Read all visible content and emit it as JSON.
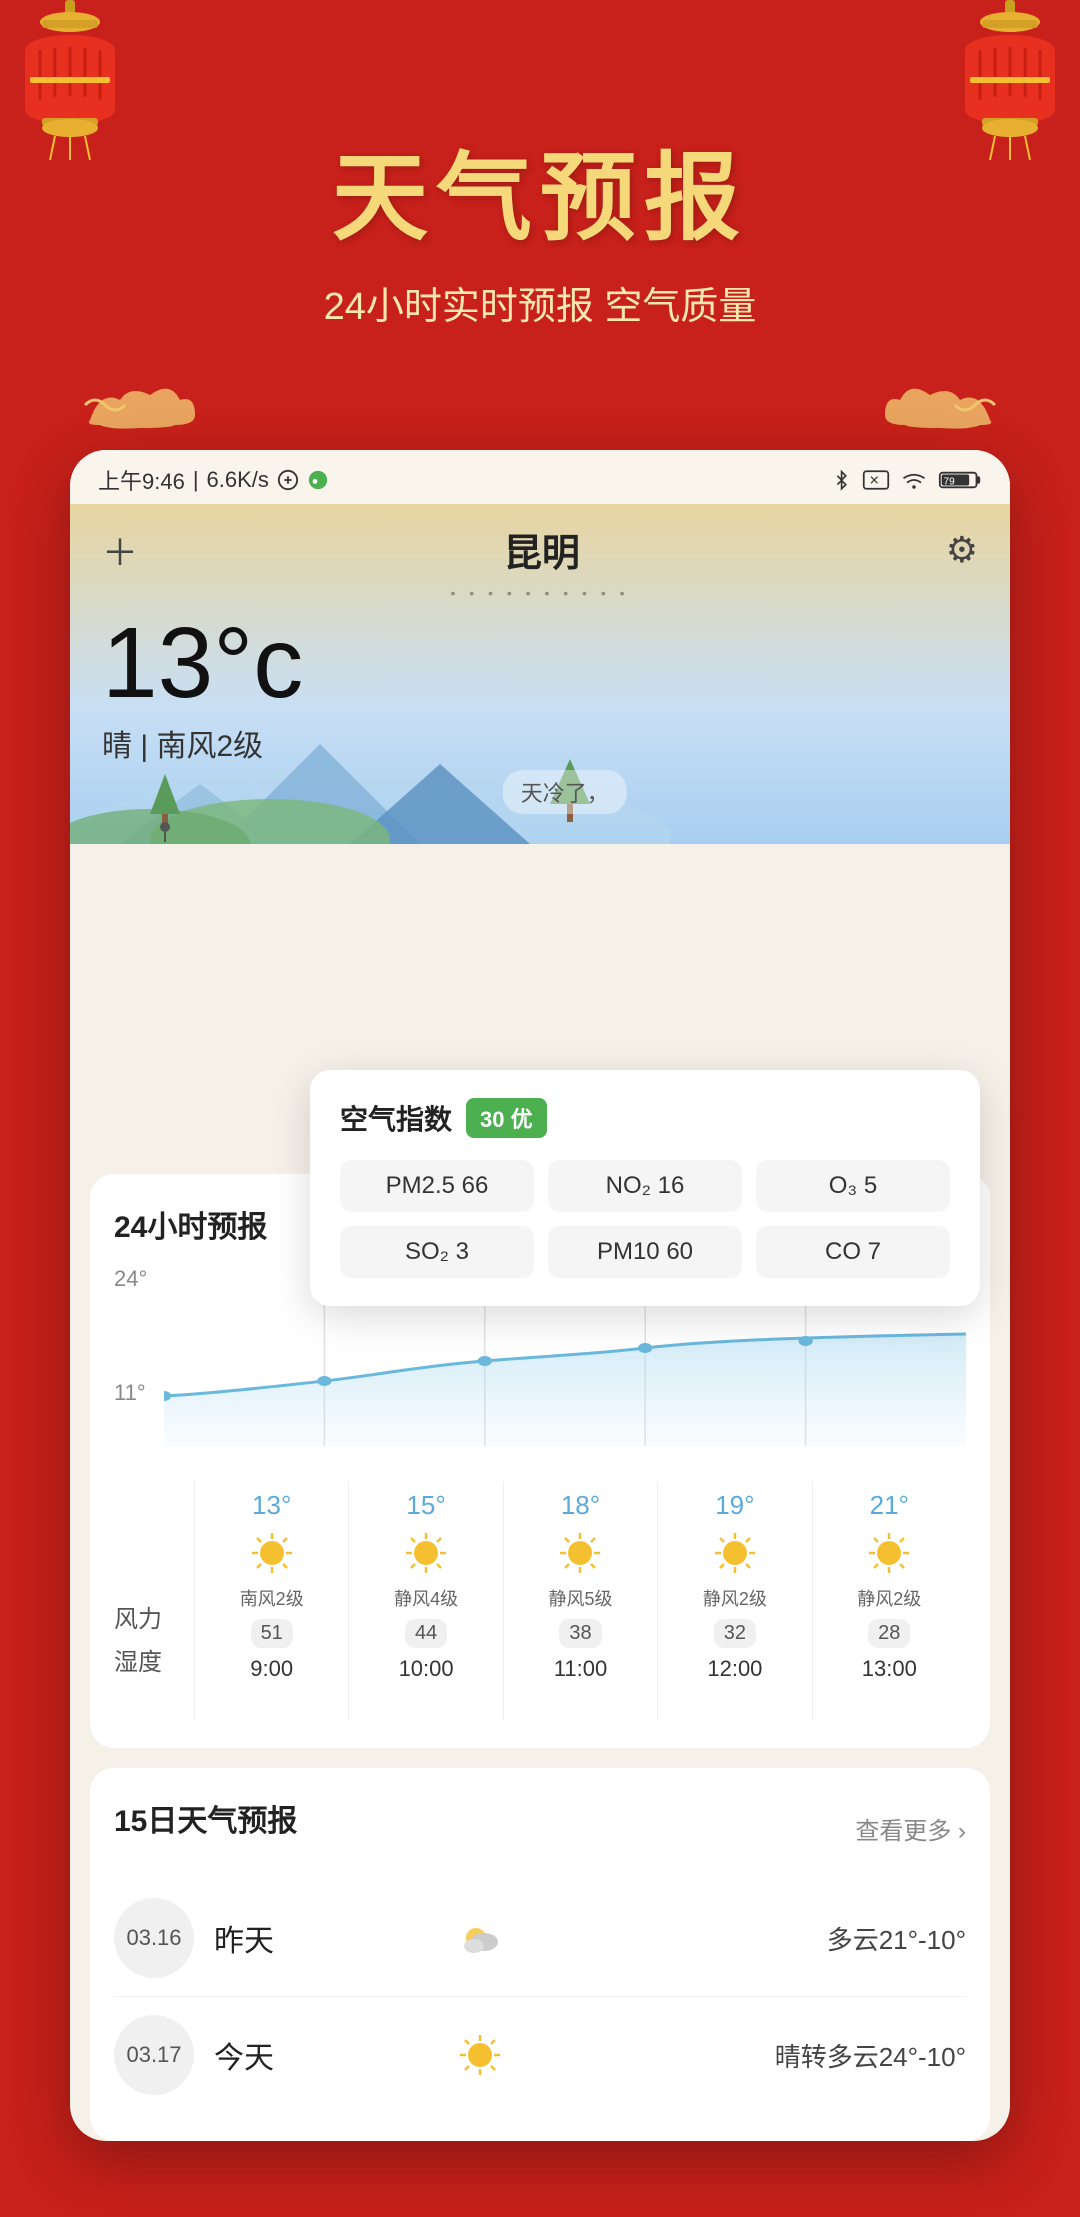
{
  "app": {
    "title": "天气预报",
    "subtitle": "24小时实时预报 空气质量"
  },
  "status_bar": {
    "time": "上午9:46",
    "network": "6.6K/s",
    "battery": "79"
  },
  "weather": {
    "city": "昆明",
    "temperature": "13°c",
    "description": "晴 | 南风2级",
    "tip": "天冷了，"
  },
  "air_quality": {
    "label": "空气指数",
    "badge": "30 优",
    "items": [
      {
        "name": "PM2.5",
        "value": "66"
      },
      {
        "name": "NO₂",
        "value": "16"
      },
      {
        "name": "O₃",
        "value": "5"
      },
      {
        "name": "SO₂",
        "value": "3"
      },
      {
        "name": "PM10",
        "value": "60"
      },
      {
        "name": "CO",
        "value": "7"
      }
    ]
  },
  "forecast24": {
    "title": "24小时预报",
    "chart_labels": {
      "top": "24°",
      "bottom": "11°"
    },
    "hours": [
      {
        "time": "9:00",
        "temp": "13°",
        "wind": "南风2级",
        "humidity": "51"
      },
      {
        "time": "10:00",
        "temp": "15°",
        "wind": "静风4级",
        "humidity": "44"
      },
      {
        "time": "11:00",
        "temp": "18°",
        "wind": "静风5级",
        "humidity": "38"
      },
      {
        "time": "12:00",
        "temp": "19°",
        "wind": "静风2级",
        "humidity": "32"
      },
      {
        "time": "13:00",
        "temp": "21°",
        "wind": "静风2级",
        "humidity": "28"
      }
    ],
    "row_labels": {
      "wind": "风力",
      "humidity": "湿度"
    }
  },
  "forecast15": {
    "title": "15日天气预报",
    "more_label": "查看更多 ›",
    "days": [
      {
        "date": "03.16",
        "day": "昨天",
        "desc": "多云21°-10°",
        "icon": "cloudy"
      },
      {
        "date": "03.17",
        "day": "今天",
        "desc": "晴转多云24°-10°",
        "icon": "sunny"
      }
    ]
  },
  "colors": {
    "primary_red": "#c8201a",
    "gold": "#f5d87a",
    "green_badge": "#4caf50",
    "sky_blue": "#5aabdb",
    "card_bg": "#ffffff"
  }
}
